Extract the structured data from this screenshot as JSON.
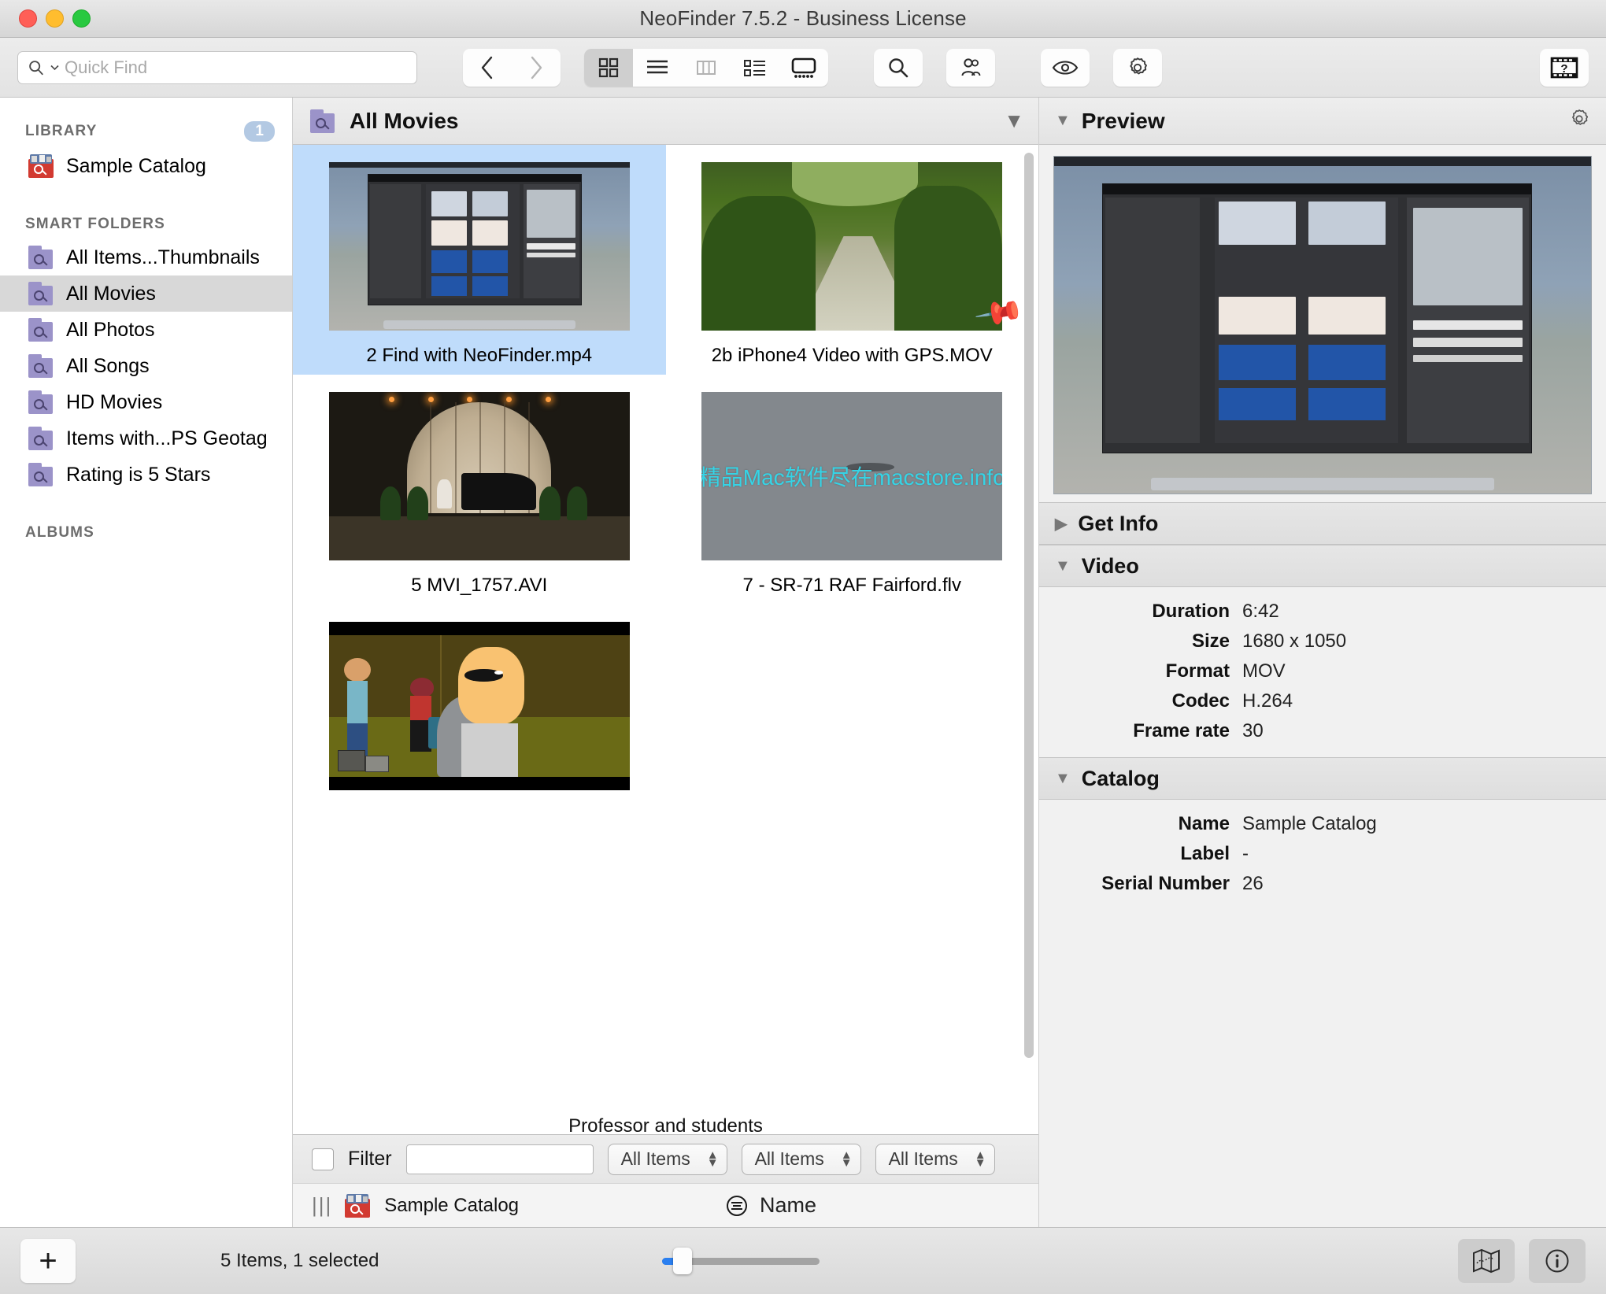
{
  "window": {
    "title": "NeoFinder 7.5.2 - Business License",
    "controls": [
      "close",
      "minimize",
      "zoom"
    ]
  },
  "toolbar": {
    "search": {
      "placeholder": "Quick Find",
      "value": ""
    },
    "nav": {
      "back": "back-icon",
      "forward": "forward-icon"
    },
    "view_modes": [
      {
        "name": "icon-view",
        "selected": true
      },
      {
        "name": "list-view",
        "selected": false
      },
      {
        "name": "column-view",
        "selected": false
      },
      {
        "name": "detail-view",
        "selected": false
      },
      {
        "name": "gallery-view",
        "selected": false
      }
    ],
    "actions": [
      {
        "name": "search-icon"
      },
      {
        "name": "people-icon"
      },
      {
        "name": "eye-icon"
      },
      {
        "name": "gear-icon"
      },
      {
        "name": "film-help-icon"
      }
    ]
  },
  "sidebar": {
    "library_header": "LIBRARY",
    "library_badge": "1",
    "library_items": [
      {
        "label": "Sample Catalog",
        "icon": "catalog-icon"
      }
    ],
    "smart_header": "SMART FOLDERS",
    "smart_items": [
      {
        "label": "All Items...Thumbnails",
        "selected": false
      },
      {
        "label": "All Movies",
        "selected": true
      },
      {
        "label": "All Photos",
        "selected": false
      },
      {
        "label": "All Songs",
        "selected": false
      },
      {
        "label": "HD Movies",
        "selected": false
      },
      {
        "label": "Items with...PS Geotag",
        "selected": false
      },
      {
        "label": "Rating is 5 Stars",
        "selected": false
      }
    ],
    "albums_header": "ALBUMS"
  },
  "content": {
    "header_title": "All Movies",
    "header_icon": "smart-folder-icon",
    "header_caret": "▼",
    "items": [
      {
        "caption": "2 Find with NeoFinder.mp4",
        "selected": true,
        "pinned": false,
        "art": "neofinder-screenshot"
      },
      {
        "caption": "2b iPhone4 Video with GPS.MOV",
        "selected": false,
        "pinned": true,
        "art": "forest-path"
      },
      {
        "caption": "5 MVI_1757.AVI",
        "selected": false,
        "pinned": false,
        "art": "stage-piano"
      },
      {
        "caption": "7 - SR-71 RAF Fairford.flv",
        "selected": false,
        "pinned": false,
        "art": "gray-sky",
        "watermark": "精品Mac软件尽在macstore.info"
      },
      {
        "caption": "",
        "selected": false,
        "pinned": false,
        "art": "cartoon-scene"
      }
    ],
    "clipped_caption": "Professor and students"
  },
  "filter": {
    "checkbox_checked": false,
    "label": "Filter",
    "text_value": "",
    "popups": [
      "All Items",
      "All Items",
      "All Items"
    ]
  },
  "pathbar": {
    "grip": "|||",
    "catalog": "Sample Catalog",
    "sort_icon": "sort-icon",
    "sort_field": "Name"
  },
  "preview": {
    "title": "Preview",
    "gear": "gear-icon",
    "sections": [
      {
        "title": "Get Info",
        "expanded": false,
        "rows": []
      },
      {
        "title": "Video",
        "expanded": true,
        "rows": [
          {
            "key": "Duration",
            "value": "6:42"
          },
          {
            "key": "Size",
            "value": "1680 x 1050"
          },
          {
            "key": "Format",
            "value": "MOV"
          },
          {
            "key": "Codec",
            "value": "H.264"
          },
          {
            "key": "Frame rate",
            "value": "30"
          }
        ]
      },
      {
        "title": "Catalog",
        "expanded": true,
        "rows": [
          {
            "key": "Name",
            "value": "Sample Catalog"
          },
          {
            "key": "Label",
            "value": "-"
          },
          {
            "key": "Serial Number",
            "value": "26"
          }
        ]
      }
    ]
  },
  "statusbar": {
    "add_label": "+",
    "status": "5 Items, 1 selected",
    "zoom_value": 10,
    "buttons": [
      {
        "name": "map-icon"
      },
      {
        "name": "info-icon"
      }
    ]
  }
}
